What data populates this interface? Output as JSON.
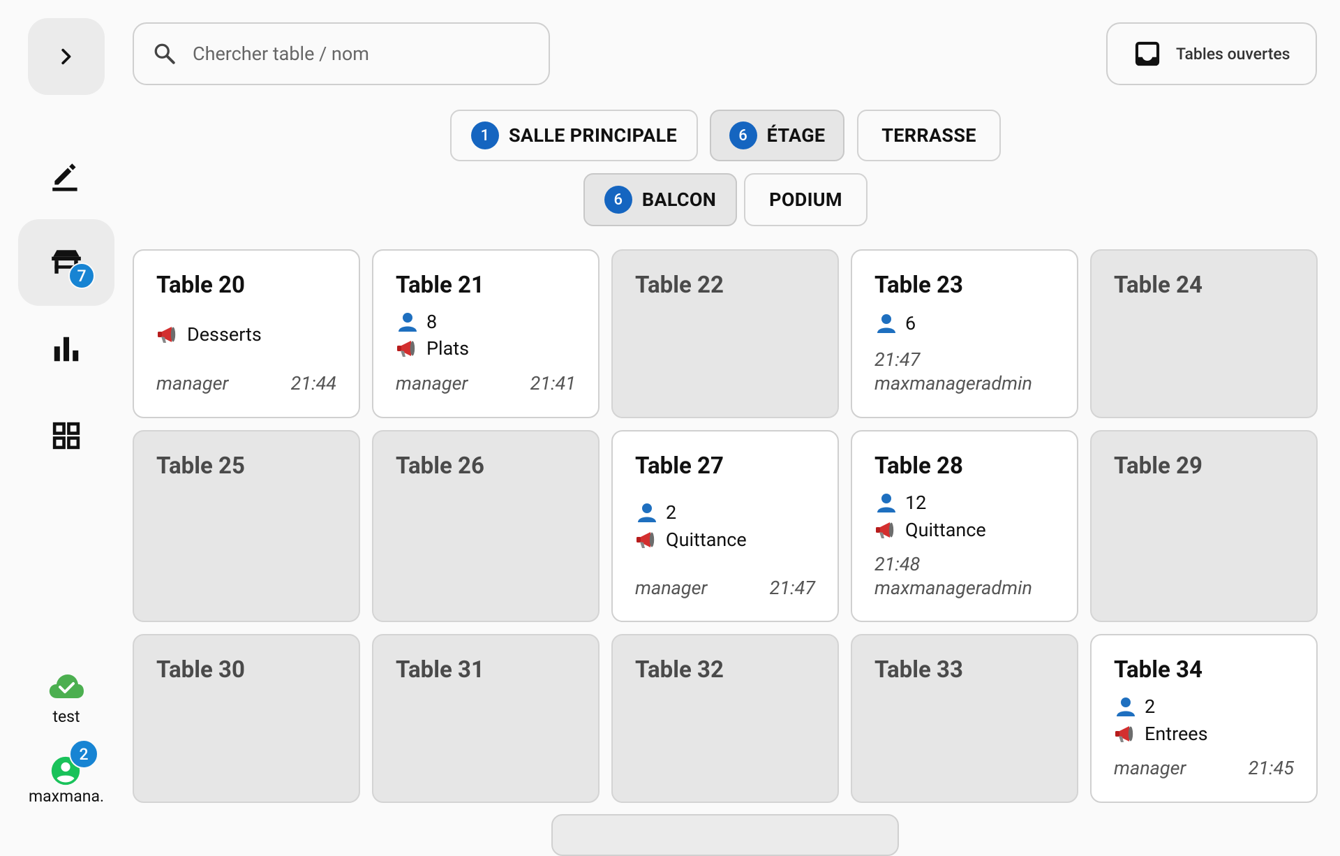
{
  "search": {
    "placeholder": "Chercher table / nom"
  },
  "header": {
    "open_tables_label": "Tables ouvertes"
  },
  "sidebar": {
    "tables_badge": "7",
    "sync_label": "test",
    "user_label": "maxmana.",
    "user_badge": "2"
  },
  "zones": [
    {
      "label": "SALLE PRINCIPALE",
      "count": "1",
      "selected": false
    },
    {
      "label": "ÉTAGE",
      "count": "6",
      "selected": true
    },
    {
      "label": "TERRASSE",
      "count": "",
      "selected": false
    },
    {
      "label": "BALCON",
      "count": "6",
      "selected": true
    },
    {
      "label": "PODIUM",
      "count": "",
      "selected": false
    }
  ],
  "tables": [
    {
      "name": "Table 20",
      "occupied": true,
      "guests": "",
      "course": "Desserts",
      "user": "manager",
      "time": "21:44"
    },
    {
      "name": "Table 21",
      "occupied": true,
      "guests": "8",
      "course": "Plats",
      "user": "manager",
      "time": "21:41"
    },
    {
      "name": "Table 22",
      "occupied": false
    },
    {
      "name": "Table 23",
      "occupied": true,
      "guests": "6",
      "course": "",
      "user": "maxmanageradmin",
      "time": "21:47"
    },
    {
      "name": "Table 24",
      "occupied": false
    },
    {
      "name": "Table 25",
      "occupied": false
    },
    {
      "name": "Table 26",
      "occupied": false
    },
    {
      "name": "Table 27",
      "occupied": true,
      "guests": "2",
      "course": "Quittance",
      "user": "manager",
      "time": "21:47"
    },
    {
      "name": "Table 28",
      "occupied": true,
      "guests": "12",
      "course": "Quittance",
      "user": "maxmanageradmin",
      "time": "21:48"
    },
    {
      "name": "Table 29",
      "occupied": false
    },
    {
      "name": "Table 30",
      "occupied": false
    },
    {
      "name": "Table 31",
      "occupied": false
    },
    {
      "name": "Table 32",
      "occupied": false
    },
    {
      "name": "Table 33",
      "occupied": false
    },
    {
      "name": "Table 34",
      "occupied": true,
      "guests": "2",
      "course": "Entrees",
      "user": "manager",
      "time": "21:45"
    }
  ],
  "colors": {
    "badge_blue": "#1784d3",
    "zone_count_blue": "#1565c0",
    "sync_green": "#4caf50",
    "user_green": "#19c25a"
  },
  "icons": [
    "chevron-right-icon",
    "edit-icon",
    "table-icon",
    "bar-chart-icon",
    "grid-icon",
    "cloud-check-icon",
    "user-circle-icon",
    "search-icon",
    "inbox-icon",
    "person-icon",
    "megaphone-icon"
  ]
}
